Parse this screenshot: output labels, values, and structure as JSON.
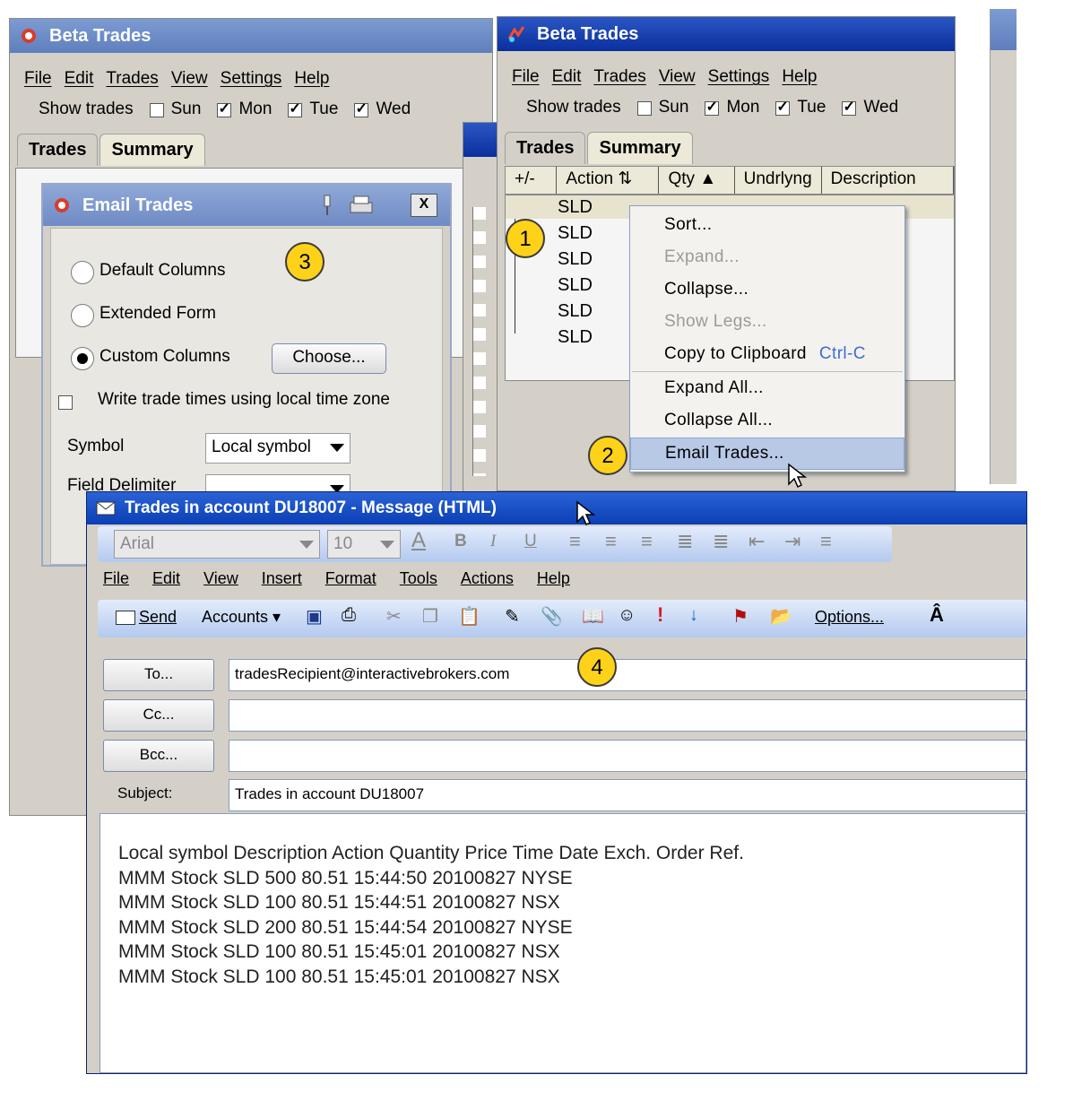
{
  "colors": {
    "badge": "#ffd21a",
    "title_active": "#0a2f9c",
    "title_inactive": "#6f8bc4",
    "menu_highlight": "#b8c9e6",
    "shortcut": "#3a6fd0"
  },
  "back_window": {
    "title": "Beta Trades",
    "menu": [
      "File",
      "Edit",
      "Trades",
      "View",
      "Settings",
      "Help"
    ],
    "show_trades_label": "Show trades",
    "days": [
      {
        "label": "Sun",
        "checked": false
      },
      {
        "label": "Mon",
        "checked": true
      },
      {
        "label": "Tue",
        "checked": true
      },
      {
        "label": "Wed",
        "checked": true
      }
    ],
    "tabs": [
      "Trades",
      "Summary"
    ]
  },
  "front_window": {
    "title": "Beta Trades",
    "menu": [
      "File",
      "Edit",
      "Trades",
      "View",
      "Settings",
      "Help"
    ],
    "show_trades_label": "Show trades",
    "days": [
      {
        "label": "Sun",
        "checked": false
      },
      {
        "label": "Mon",
        "checked": true
      },
      {
        "label": "Tue",
        "checked": true
      },
      {
        "label": "Wed",
        "checked": true
      }
    ],
    "tabs": [
      "Trades",
      "Summary"
    ],
    "columns": [
      "+/-",
      "Action",
      "Qty",
      "Undrlyng",
      "Description"
    ],
    "rows": [
      "SLD",
      "SLD",
      "SLD",
      "SLD",
      "SLD",
      "SLD"
    ]
  },
  "context_menu": {
    "items": [
      {
        "label": "Sort...",
        "disabled": false
      },
      {
        "label": "Expand...",
        "disabled": true
      },
      {
        "label": "Collapse...",
        "disabled": false
      },
      {
        "label": "Show Legs...",
        "disabled": true
      },
      {
        "label": "Copy to Clipboard",
        "shortcut": "Ctrl-C",
        "disabled": false
      },
      {
        "label": "Expand All...",
        "disabled": false
      },
      {
        "label": "Collapse All...",
        "disabled": false
      },
      {
        "label": "Email Trades...",
        "disabled": false,
        "highlighted": true
      }
    ]
  },
  "badges": [
    "1",
    "2",
    "3",
    "4"
  ],
  "email_dialog": {
    "title": "Email Trades",
    "options": [
      {
        "label": "Default Columns",
        "selected": false
      },
      {
        "label": "Extended Form",
        "selected": false
      },
      {
        "label": "Custom Columns",
        "selected": true
      }
    ],
    "choose_button": "Choose...",
    "local_time_label": "Write trade times using local time zone",
    "symbol_label": "Symbol",
    "symbol_value": "Local symbol",
    "delimiter_label": "Field Delimiter",
    "close_glyph": "X"
  },
  "message": {
    "title": "Trades in account DU18007  - Message (HTML)",
    "font_name": "Arial",
    "font_size": "10",
    "menu": [
      "File",
      "Edit",
      "View",
      "Insert",
      "Format",
      "Tools",
      "Actions",
      "Help"
    ],
    "send_label": "Send",
    "accounts_label": "Accounts",
    "options_label": "Options...",
    "to_button": "To...",
    "cc_button": "Cc...",
    "bcc_button": "Bcc...",
    "subject_label": "Subject:",
    "to_value": "tradesRecipient@interactivebrokers.com",
    "cc_value": "",
    "bcc_value": "",
    "subject_value": "Trades in account DU18007",
    "body_lines": [
      "Local symbol Description Action Quantity Price Time Date Exch. Order Ref.",
      "MMM Stock SLD 500 80.51 15:44:50 20100827 NYSE",
      "MMM Stock SLD 100 80.51 15:44:51 20100827 NSX",
      "MMM Stock SLD 200 80.51 15:44:54 20100827 NYSE",
      "MMM Stock SLD 100 80.51 15:45:01 20100827 NSX",
      "MMM Stock SLD 100 80.51 15:45:01 20100827 NSX"
    ]
  }
}
